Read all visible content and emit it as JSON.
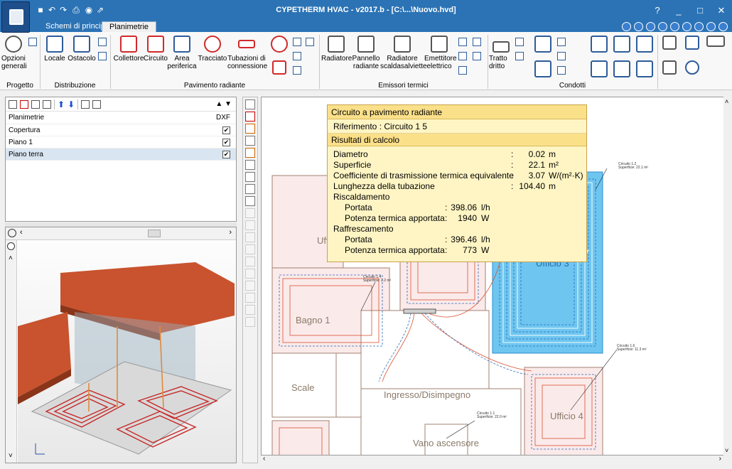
{
  "window": {
    "title": "CYPETHERM HVAC - v2017.b - [C:\\...\\Nuovo.hvd]",
    "help": "?",
    "minimize": "_",
    "maximize": "□",
    "close": "✕"
  },
  "tabs": [
    {
      "label": "Schemi di principio"
    },
    {
      "label": "Planimetrie"
    }
  ],
  "ribbon": {
    "opzioni_generali": "Opzioni\ngenerali",
    "locale": "Locale",
    "ostacolo": "Ostacolo",
    "collettore": "Collettore",
    "circuito": "Circuito",
    "area_periferica": "Area\nperiferica",
    "tracciato": "Tracciato",
    "tubazioni": "Tubazioni di\nconnessione",
    "radiatore": "Radiatore",
    "pannello": "Pannello\nradiante",
    "scaldasalviette": "Radiatore\nscaldasalviette",
    "emettitore": "Emettitore\nelettrico",
    "tratto": "Tratto\ndritto",
    "groups": {
      "progetto": "Progetto",
      "distribuzione": "Distribuzione",
      "pavimento": "Pavimento radiante",
      "emissori": "Emissori termici",
      "condotti": "Condotti"
    }
  },
  "plan_panel": {
    "header": "Planimetrie",
    "dxf": "DXF",
    "rows": [
      {
        "name": "Copertura",
        "dxf": "✔"
      },
      {
        "name": "Piano 1",
        "dxf": "✔"
      },
      {
        "name": "Piano terra",
        "dxf": "✔"
      }
    ]
  },
  "tooltip": {
    "title": "Circuito a pavimento radiante",
    "riferimento_label": "Riferimento",
    "riferimento_value": "Circuito 1 5",
    "section": "Risultati di calcolo",
    "rows": [
      {
        "label": "Diametro",
        "value": "0.02",
        "unit": "m"
      },
      {
        "label": "Superficie",
        "value": "22.1",
        "unit": "m²"
      },
      {
        "label": "Coefficiente di trasmissione termica equivalente",
        "value": "3.07",
        "unit": "W/(m²·K)"
      },
      {
        "label": "Lunghezza della tubazione",
        "value": "104.40",
        "unit": "m"
      }
    ],
    "riscaldamento": "Riscaldamento",
    "risc_portata": {
      "label": "Portata",
      "value": "398.06",
      "unit": "l/h"
    },
    "risc_potenza": {
      "label": "Potenza termica apportata",
      "value": "1940",
      "unit": "W"
    },
    "raffrescamento": "Raffrescamento",
    "raff_portata": {
      "label": "Portata",
      "value": "396.46",
      "unit": "l/h"
    },
    "raff_potenza": {
      "label": "Potenza termica apportata",
      "value": "773",
      "unit": "W"
    }
  },
  "rooms": {
    "uffi": "Uffi",
    "bagno": "Bagno 1",
    "ufficio3": "Ufficio 3",
    "scale": "Scale",
    "ingresso": "Ingresso/Disimpegno",
    "ufficio4": "Ufficio 4",
    "vano": "Vano ascensore"
  },
  "notes": {
    "n1": "Circuito 1.2",
    "n1b": "Superficie: 22.1 m²",
    "n2": "Circuito 1.4",
    "n2b": "Superficie: 2.2 m²",
    "n3": "Circuito 1.6",
    "n3b": "Superficie: 11.3 m²",
    "n4": "Circuito 1.1",
    "n4b": "Superficie: 22.0 m²"
  }
}
